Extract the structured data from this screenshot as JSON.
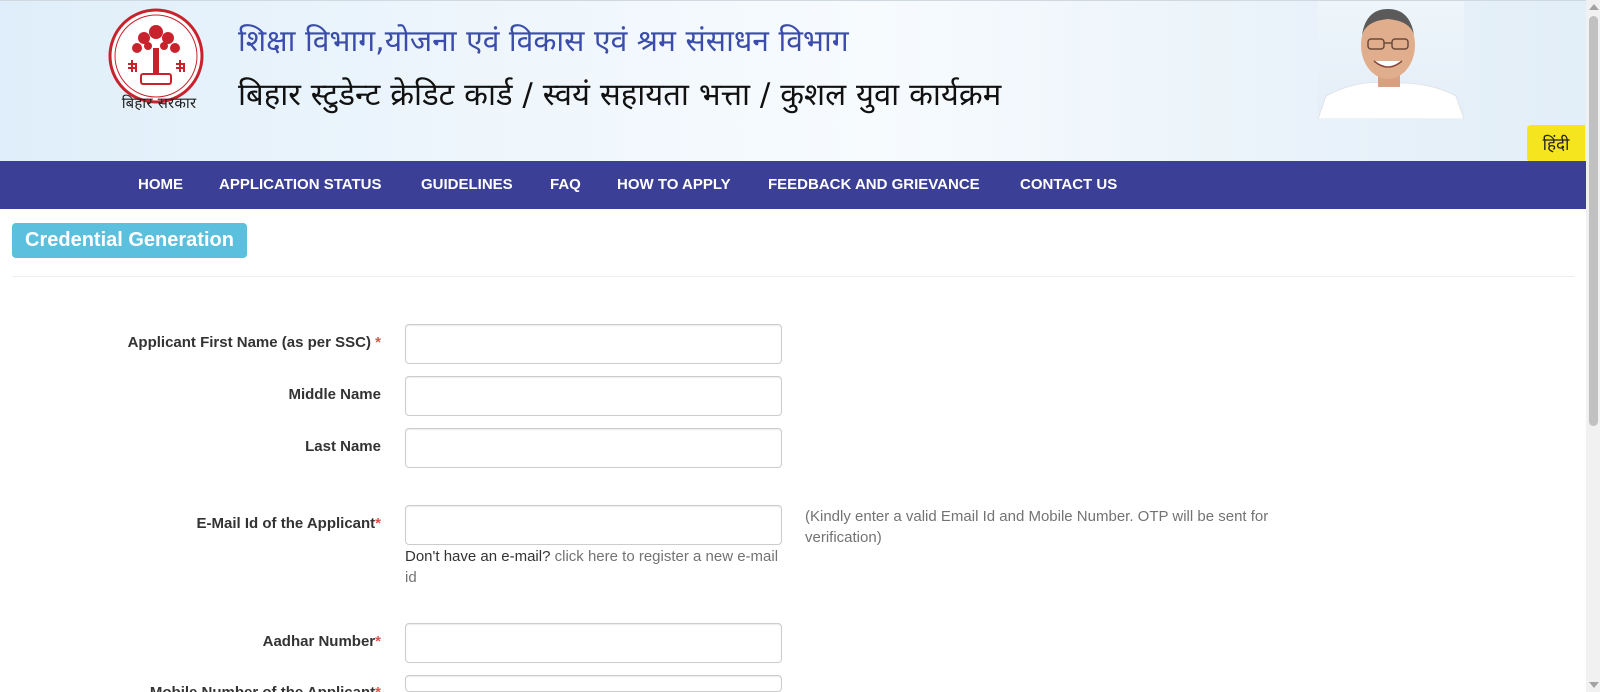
{
  "header": {
    "department_title": "शिक्षा विभाग,योजना एवं विकास एवं श्रम संसाधन विभाग",
    "scheme_title": "बिहार स्टुडेन्ट क्रेडिट कार्ड / स्वयं सहायता भत्ता / कुशल युवा कार्यक्रम",
    "emblem_caption": "बिहार सरकार",
    "language_toggle": "हिंदी"
  },
  "nav": {
    "items": [
      {
        "label": "HOME"
      },
      {
        "label": "APPLICATION STATUS"
      },
      {
        "label": "GUIDELINES"
      },
      {
        "label": "FAQ"
      },
      {
        "label": "HOW TO APPLY"
      },
      {
        "label": "FEEDBACK AND GRIEVANCE"
      },
      {
        "label": "CONTACT US"
      }
    ]
  },
  "form": {
    "section_title": "Credential Generation",
    "fields": {
      "first_name": {
        "label": "Applicant First Name (as per SSC)",
        "required_mark": "*",
        "value": ""
      },
      "middle_name": {
        "label": "Middle Name",
        "value": ""
      },
      "last_name": {
        "label": "Last Name",
        "value": ""
      },
      "email": {
        "label": "E-Mail Id of the Applicant",
        "required_mark": "*",
        "value": ""
      },
      "aadhar": {
        "label": "Aadhar Number",
        "required_mark": "*",
        "value": ""
      },
      "mobile": {
        "label": "Mobile Number of the Applicant",
        "required_mark": "*",
        "value": ""
      }
    },
    "email_hint": "(Kindly enter a valid Email Id and Mobile Number. OTP will be sent for verification)",
    "no_email_prefix": "Don't have an e-mail?",
    "register_email_link": "click here to register a new e-mail id"
  },
  "colors": {
    "nav_bg": "#3b3f95",
    "badge_bg": "#5bc0de",
    "lang_button_bg": "#f4e51f",
    "dept_title": "#3b4cab",
    "required": "#d9534f"
  },
  "icons": {
    "emblem": "bihar-government-emblem",
    "portrait": "chief-minister-photo"
  }
}
